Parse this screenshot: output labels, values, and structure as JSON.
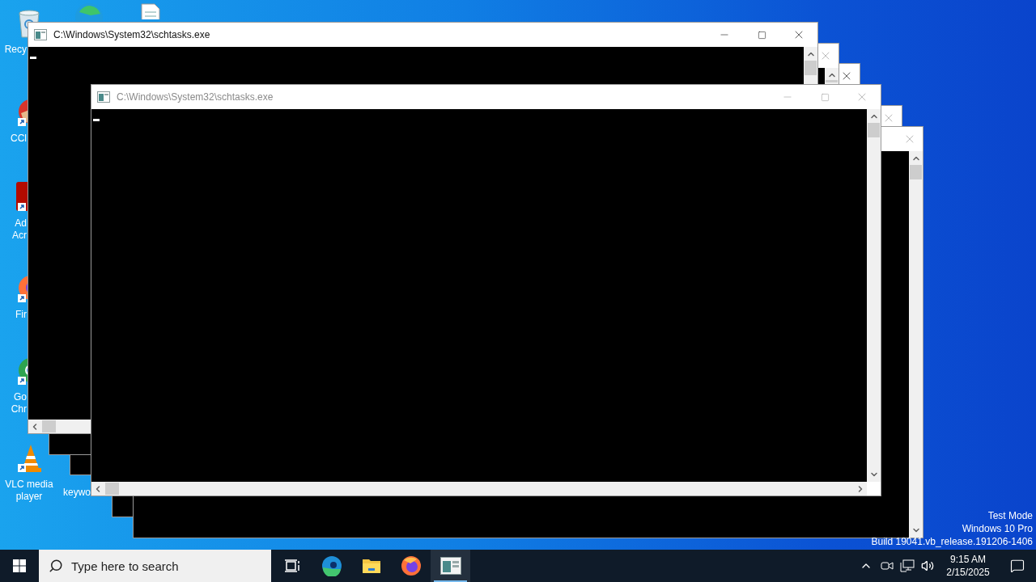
{
  "desktop_icons": [
    {
      "kind": "recycle-bin",
      "label": [
        "Recy"
      ]
    },
    {
      "kind": "edge"
    },
    {
      "kind": "document"
    },
    {
      "kind": "ccleaner",
      "label": [
        "CCl"
      ]
    },
    {
      "kind": "acrobat",
      "label": [
        "Ad",
        "Acr"
      ]
    },
    {
      "kind": "firefox",
      "label": [
        "Fir"
      ]
    },
    {
      "kind": "chrome",
      "label": [
        "Go",
        "Chr"
      ]
    },
    {
      "kind": "vlc",
      "label": [
        "VLC media",
        "player"
      ]
    },
    {
      "kind": "hidden",
      "label": [
        "keywo"
      ]
    }
  ],
  "windows": [
    {
      "active": false
    },
    {
      "active": true
    },
    {
      "active": false
    },
    {
      "active": false
    },
    {
      "title": "C:\\Windows\\System32\\schtasks.exe",
      "active": true,
      "cursor_visible": true,
      "horizontal_scrollbar": true
    },
    {
      "title": "C:\\Windows\\System32\\schtasks.exe",
      "active": false,
      "cursor_visible": true,
      "horizontal_scrollbar": true
    }
  ],
  "system_note": [
    "Test Mode",
    "Windows 10 Pro",
    "Build 19041.vb_release.191206-1406"
  ],
  "taskbar": {
    "search": {
      "placeholder": "Type here to search"
    },
    "apps": [
      {
        "kind": "task-view",
        "selected": false
      },
      {
        "kind": "edge",
        "selected": false
      },
      {
        "kind": "explorer",
        "selected": false
      },
      {
        "kind": "firefox",
        "selected": false
      },
      {
        "kind": "console",
        "selected": true
      }
    ],
    "time": "9:15 AM",
    "date": "2/15/2025"
  }
}
